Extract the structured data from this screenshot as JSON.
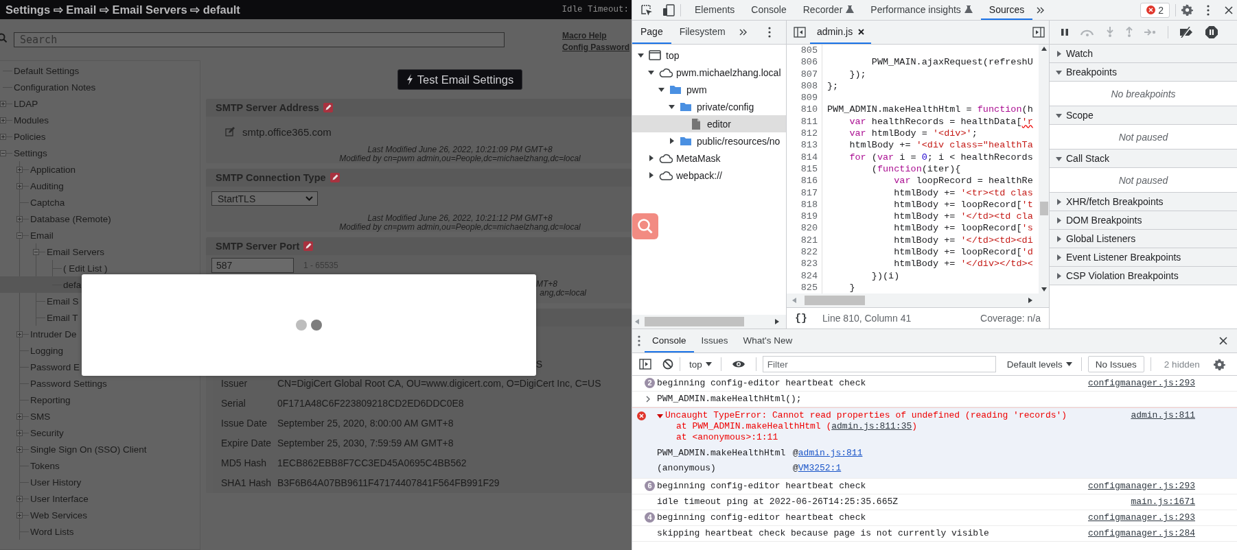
{
  "webpage": {
    "breadcrumb": "Settings ⇨ Email ⇨ Email Servers ⇨ default",
    "idle_timeout_label": "Idle Timeout:",
    "search": {
      "placeholder": "Search"
    },
    "links": [
      "Macro Help",
      "Config Password"
    ],
    "tree": [
      {
        "label": "Default Settings",
        "selected": false
      },
      {
        "label": "Configuration Notes",
        "selected": false
      },
      {
        "label": "LDAP",
        "expanded": false,
        "selected": false
      },
      {
        "label": "Modules",
        "expanded": false,
        "selected": false
      },
      {
        "label": "Policies",
        "expanded": false,
        "selected": false
      },
      {
        "label": "Settings",
        "expanded": true,
        "selected": false,
        "children": [
          {
            "label": "Application",
            "expanded": false,
            "selected": false
          },
          {
            "label": "Auditing",
            "expanded": false,
            "selected": false
          },
          {
            "label": "Captcha",
            "selected": false
          },
          {
            "label": "Database (Remote)",
            "expanded": false,
            "selected": false
          },
          {
            "label": "Email",
            "expanded": true,
            "selected": false,
            "children": [
              {
                "label": "Email Servers",
                "expanded": true,
                "selected": false,
                "children": [
                  {
                    "label": "( Edit List )",
                    "selected": false
                  },
                  {
                    "label": "defa",
                    "selected": true
                  }
                ]
              },
              {
                "label": "Email S",
                "selected": false
              },
              {
                "label": "Email T",
                "selected": false
              }
            ]
          },
          {
            "label": "Intruder De",
            "expanded": false,
            "selected": false
          },
          {
            "label": "Logging",
            "selected": false
          },
          {
            "label": "Password E",
            "selected": false
          },
          {
            "label": "Password Settings",
            "selected": false
          },
          {
            "label": "Reporting",
            "selected": false
          },
          {
            "label": "SMS",
            "expanded": false,
            "selected": false
          },
          {
            "label": "Security",
            "expanded": false,
            "selected": false
          },
          {
            "label": "Single Sign On (SSO) Client",
            "expanded": false,
            "selected": false
          },
          {
            "label": "Tokens",
            "selected": false
          },
          {
            "label": "User History",
            "selected": false
          },
          {
            "label": "User Interface",
            "expanded": false,
            "selected": false
          },
          {
            "label": "Web Services",
            "expanded": false,
            "selected": false
          },
          {
            "label": "Word Lists",
            "selected": false
          }
        ]
      }
    ],
    "test_button": "Test Email Settings",
    "sections": [
      {
        "kind": "text",
        "title": "SMTP Server Address",
        "value": "smtp.office365.com",
        "modified": [
          "Last Modified June 26, 2022, 10:21:09 PM GMT+8",
          "Modified by cn=pwm admin,ou=People,dc=michaelzhang,dc=local"
        ]
      },
      {
        "kind": "select",
        "title": "SMTP Connection Type",
        "value": "StartTLS",
        "modified": [
          "Last Modified June 26, 2022, 10:21:12 PM GMT+8",
          "Modified by cn=pwm admin,ou=People,dc=michaelzhang,dc=local"
        ]
      },
      {
        "kind": "number",
        "title": "SMTP Server Port",
        "value": "587",
        "range": "1 - 65535",
        "modified_fragments": [
          "MT+8",
          "ang,dc=local"
        ]
      },
      {
        "kind": "certificate",
        "rows": [
          {
            "kind": "fragment",
            "value": "S"
          },
          {
            "kind": "row",
            "label": "Issuer",
            "value": "CN=DigiCert Global Root CA, OU=www.digicert.com, O=DigiCert Inc, C=US"
          },
          {
            "kind": "row",
            "label": "Serial",
            "value": "0F171A48C6F223809218CD2ED6DDC0E8"
          },
          {
            "kind": "row",
            "label": "Issue Date",
            "value": "September 25, 2020, 8:00:00 AM GMT+8"
          },
          {
            "kind": "row",
            "label": "Expire Date",
            "value": "September 25, 2030, 7:59:59 AM GMT+8"
          },
          {
            "kind": "row",
            "label": "MD5 Hash",
            "value": "1ECB862EBB8F7CC3ED45A0695C4BB562"
          },
          {
            "kind": "row",
            "label": "SHA1 Hash",
            "value": "B3F6B64A07BB9611F47174407841F564FB991F29"
          }
        ]
      }
    ]
  },
  "devtools": {
    "tabs": [
      {
        "label": "Elements",
        "kind": "plain",
        "selected": false
      },
      {
        "label": "Console",
        "kind": "plain",
        "selected": false
      },
      {
        "label": "Recorder",
        "kind": "experimental",
        "selected": false
      },
      {
        "label": "Performance insights",
        "kind": "experimental",
        "selected": false
      },
      {
        "label": "Sources",
        "kind": "plain",
        "selected": true
      }
    ],
    "error_count": "2",
    "navigator": {
      "tabs": [
        {
          "label": "Page",
          "selected": true
        },
        {
          "label": "Filesystem",
          "selected": false
        }
      ],
      "tree": [
        {
          "label": "top",
          "kind": "frame",
          "expanded": true,
          "selected": false,
          "children": [
            {
              "label": "pwm.michaelzhang.local",
              "kind": "domain",
              "expanded": true,
              "selected": false,
              "children": [
                {
                  "label": "pwm",
                  "kind": "folder",
                  "expanded": true,
                  "selected": false,
                  "children": [
                    {
                      "label": "private/config",
                      "kind": "folder",
                      "expanded": true,
                      "selected": false,
                      "children": [
                        {
                          "label": "editor",
                          "kind": "file",
                          "selected": true
                        }
                      ]
                    },
                    {
                      "label": "public/resources/no",
                      "kind": "folder",
                      "expanded": false,
                      "selected": false
                    }
                  ]
                }
              ]
            },
            {
              "label": "MetaMask",
              "kind": "domain",
              "expanded": false,
              "selected": false
            },
            {
              "label": "webpack://",
              "kind": "domain",
              "expanded": false,
              "selected": false
            }
          ]
        }
      ]
    },
    "editor": {
      "tab": "admin.js",
      "lines": [
        {
          "number": "805"
        },
        {
          "number": "806",
          "tokens": [
            {
              "text": "        PWM_MAIN.ajaxRequest(refreshU",
              "kind": "plain"
            }
          ]
        },
        {
          "number": "807",
          "tokens": [
            {
              "text": "    });",
              "kind": "plain"
            }
          ]
        },
        {
          "number": "808",
          "tokens": [
            {
              "text": "};",
              "kind": "plain"
            }
          ]
        },
        {
          "number": "809"
        },
        {
          "number": "810",
          "tokens": [
            {
              "text": "PWM_ADMIN.makeHealthHtml = ",
              "kind": "plain"
            },
            {
              "text": "function",
              "kind": "keyword"
            },
            {
              "text": "(h",
              "kind": "plain"
            }
          ]
        },
        {
          "number": "811",
          "tokens": [
            {
              "text": "    var",
              "kind": "keyword"
            },
            {
              "text": " healthRecords = healthData[",
              "kind": "plain"
            },
            {
              "text": "'r",
              "kind": "string",
              "error": true
            }
          ]
        },
        {
          "number": "812",
          "tokens": [
            {
              "text": "    var",
              "kind": "keyword"
            },
            {
              "text": " htmlBody = ",
              "kind": "plain"
            },
            {
              "text": "'<div>'",
              "kind": "string"
            },
            {
              "text": ";",
              "kind": "plain"
            }
          ]
        },
        {
          "number": "813",
          "tokens": [
            {
              "text": "    htmlBody += ",
              "kind": "plain"
            },
            {
              "text": "'<div class=\"healthTa",
              "kind": "string"
            }
          ]
        },
        {
          "number": "814",
          "tokens": [
            {
              "text": "    for",
              "kind": "keyword"
            },
            {
              "text": " (",
              "kind": "plain"
            },
            {
              "text": "var",
              "kind": "keyword"
            },
            {
              "text": " i = ",
              "kind": "plain"
            },
            {
              "text": "0",
              "kind": "number"
            },
            {
              "text": "; i < healthRecords",
              "kind": "plain"
            }
          ]
        },
        {
          "number": "815",
          "tokens": [
            {
              "text": "        (",
              "kind": "plain"
            },
            {
              "text": "function",
              "kind": "keyword"
            },
            {
              "text": "(iter){",
              "kind": "plain"
            }
          ]
        },
        {
          "number": "816",
          "tokens": [
            {
              "text": "            var",
              "kind": "keyword"
            },
            {
              "text": " loopRecord = healthRe",
              "kind": "plain"
            }
          ]
        },
        {
          "number": "817",
          "tokens": [
            {
              "text": "            htmlBody += ",
              "kind": "plain"
            },
            {
              "text": "'<tr><td clas",
              "kind": "string"
            }
          ]
        },
        {
          "number": "818",
          "tokens": [
            {
              "text": "            htmlBody += loopRecord[",
              "kind": "plain"
            },
            {
              "text": "'t",
              "kind": "string"
            }
          ]
        },
        {
          "number": "819",
          "tokens": [
            {
              "text": "            htmlBody += ",
              "kind": "plain"
            },
            {
              "text": "'</td><td cla",
              "kind": "string"
            }
          ]
        },
        {
          "number": "820",
          "tokens": [
            {
              "text": "            htmlBody += loopRecord[",
              "kind": "plain"
            },
            {
              "text": "'s",
              "kind": "string"
            }
          ]
        },
        {
          "number": "821",
          "tokens": [
            {
              "text": "            htmlBody += ",
              "kind": "plain"
            },
            {
              "text": "'</td><td><di",
              "kind": "string"
            }
          ]
        },
        {
          "number": "822",
          "tokens": [
            {
              "text": "            htmlBody += loopRecord[",
              "kind": "plain"
            },
            {
              "text": "'d",
              "kind": "string"
            }
          ]
        },
        {
          "number": "823",
          "tokens": [
            {
              "text": "            htmlBody += ",
              "kind": "plain"
            },
            {
              "text": "'</div></td><",
              "kind": "string"
            }
          ]
        },
        {
          "number": "824",
          "tokens": [
            {
              "text": "        })(i)",
              "kind": "plain"
            }
          ]
        },
        {
          "number": "825",
          "tokens": [
            {
              "text": "    }",
              "kind": "plain"
            }
          ]
        }
      ],
      "format_button": "{}",
      "position": "Line 810, Column 41",
      "coverage": "Coverage: n/a"
    },
    "debugger": {
      "sections": [
        {
          "title": "Watch",
          "expanded": false
        },
        {
          "title": "Breakpoints",
          "expanded": true,
          "message": "No breakpoints"
        },
        {
          "title": "Scope",
          "expanded": true,
          "message": "Not paused"
        },
        {
          "title": "Call Stack",
          "expanded": true,
          "message": "Not paused"
        },
        {
          "title": "XHR/fetch Breakpoints",
          "expanded": false
        },
        {
          "title": "DOM Breakpoints",
          "expanded": false
        },
        {
          "title": "Global Listeners",
          "expanded": false
        },
        {
          "title": "Event Listener Breakpoints",
          "expanded": false
        },
        {
          "title": "CSP Violation Breakpoints",
          "expanded": false
        }
      ]
    },
    "drawer": {
      "tabs": [
        {
          "label": "Console",
          "selected": true
        },
        {
          "label": "Issues",
          "selected": false
        },
        {
          "label": "What's New",
          "selected": false
        }
      ],
      "context": "top",
      "filter": {
        "placeholder": "Filter"
      },
      "levels": "Default levels",
      "issues": "No Issues",
      "hidden": "2 hidden",
      "messages": [
        {
          "kind": "log",
          "count": "2",
          "text": "beginning config-editor heartbeat check",
          "source": "configmanager.js:293"
        },
        {
          "kind": "input",
          "text": "PWM_ADMIN.makeHealthHtml();"
        },
        {
          "kind": "error",
          "expanded": true,
          "text": "Uncaught TypeError: Cannot read properties of undefined (reading 'records')",
          "source": "admin.js:811",
          "stack": [
            {
              "text": "at PWM_ADMIN.makeHealthHtml (",
              "link": "admin.js:811:35",
              "after": ")"
            },
            {
              "text": "at <anonymous>:1:11"
            }
          ],
          "frames": [
            {
              "name": "PWM_ADMIN.makeHealthHtml",
              "at": "@",
              "link": "admin.js:811"
            },
            {
              "name": "(anonymous)",
              "at": "@",
              "link": "VM3252:1"
            }
          ]
        },
        {
          "kind": "log",
          "count": "6",
          "text": "beginning config-editor heartbeat check",
          "source": "configmanager.js:293"
        },
        {
          "kind": "log",
          "text": "idle timeout ping at 2022-06-26T14:25:35.665Z",
          "source": "main.js:1671"
        },
        {
          "kind": "log",
          "count": "4",
          "text": "beginning config-editor heartbeat check",
          "source": "configmanager.js:293"
        },
        {
          "kind": "log",
          "text": "skipping heartbeat check because page is not currently visible",
          "source": "configmanager.js:284"
        }
      ]
    }
  }
}
